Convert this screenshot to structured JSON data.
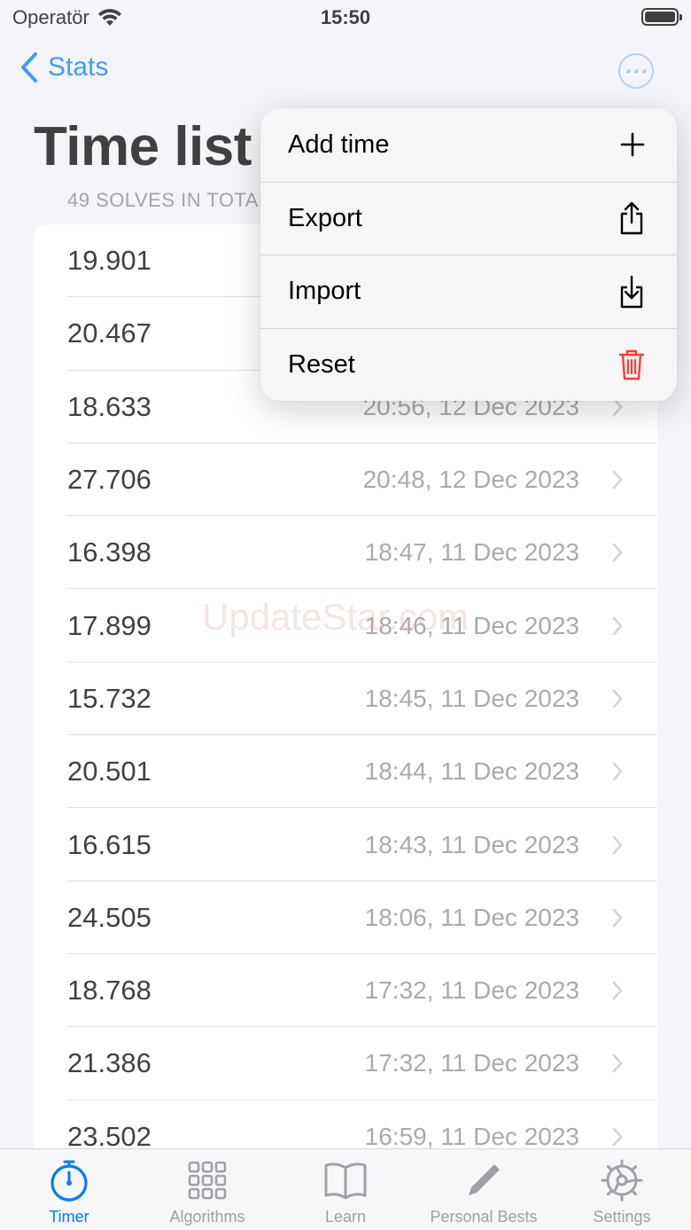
{
  "status": {
    "carrier": "Operatör",
    "time": "15:50"
  },
  "nav": {
    "back_label": "Stats"
  },
  "page": {
    "title": "Time list",
    "section_header": "49 SOLVES IN TOTAL"
  },
  "rows": [
    {
      "time": "19.901",
      "date": ""
    },
    {
      "time": "20.467",
      "date": ""
    },
    {
      "time": "18.633",
      "date": "20:56, 12 Dec 2023"
    },
    {
      "time": "27.706",
      "date": "20:48, 12 Dec 2023"
    },
    {
      "time": "16.398",
      "date": "18:47, 11 Dec 2023"
    },
    {
      "time": "17.899",
      "date": "18:46, 11 Dec 2023"
    },
    {
      "time": "15.732",
      "date": "18:45, 11 Dec 2023"
    },
    {
      "time": "20.501",
      "date": "18:44, 11 Dec 2023"
    },
    {
      "time": "16.615",
      "date": "18:43, 11 Dec 2023"
    },
    {
      "time": "24.505",
      "date": "18:06, 11 Dec 2023"
    },
    {
      "time": "18.768",
      "date": "17:32, 11 Dec 2023"
    },
    {
      "time": "21.386",
      "date": "17:32, 11 Dec 2023"
    },
    {
      "time": "23.502",
      "date": "16:59, 11 Dec 2023"
    }
  ],
  "menu": {
    "add": "Add time",
    "export": "Export",
    "import": "Import",
    "reset": "Reset"
  },
  "tabs": {
    "timer": "Timer",
    "algorithms": "Algorithms",
    "learn": "Learn",
    "personal_bests": "Personal Bests",
    "settings": "Settings"
  },
  "watermark": "UpdateStar.com",
  "colors": {
    "accent": "#007aff",
    "danger": "#ff3b30",
    "secondary_text": "#8e8e93"
  }
}
